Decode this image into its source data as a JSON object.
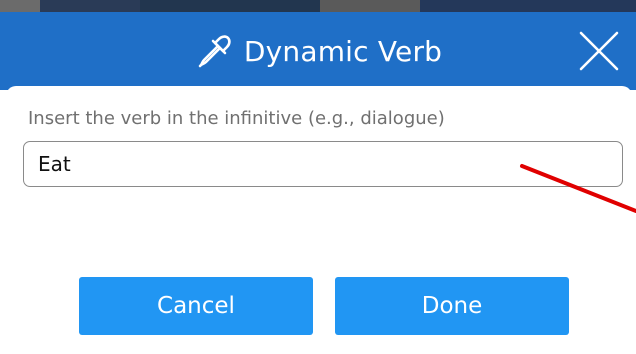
{
  "dialog": {
    "title": "Dynamic Verb",
    "title_icon": "eyedropper-icon",
    "close_icon": "close-icon",
    "accent_color": "#1f6fc7",
    "button_color": "#2196f3"
  },
  "form": {
    "label": "Insert the verb in the infinitive (e.g., dialogue)",
    "input_value": "Eat"
  },
  "buttons": {
    "cancel_label": "Cancel",
    "done_label": "Done"
  },
  "annotation": {
    "type": "red-arrow",
    "color": "#e00000"
  }
}
